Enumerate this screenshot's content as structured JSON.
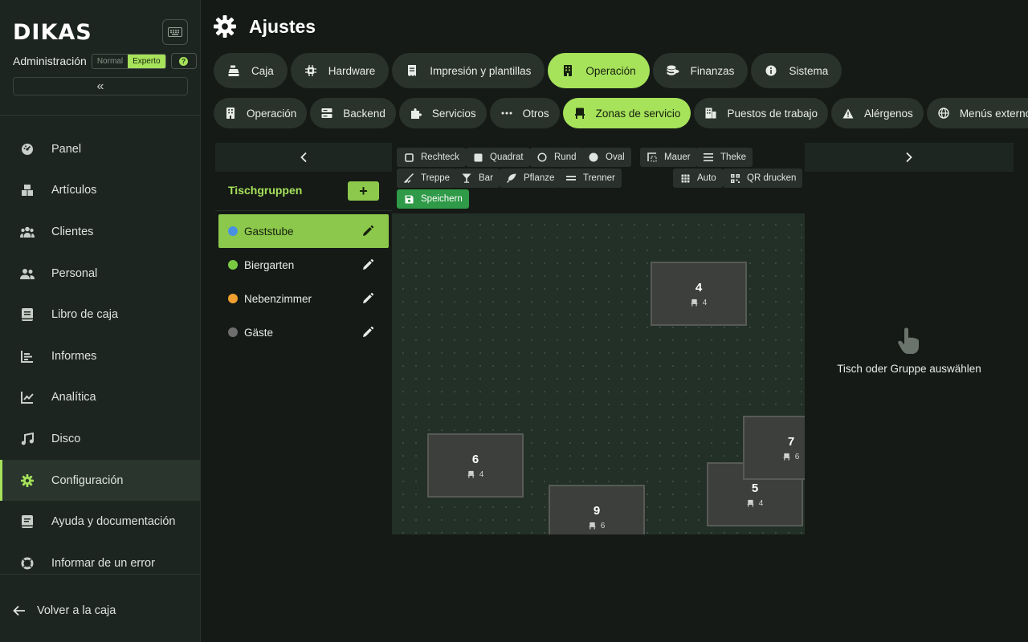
{
  "sidebar": {
    "logo": "DIKAS",
    "admin_label": "Administración",
    "modes": [
      "Normal",
      "Experto"
    ],
    "active_mode": "Experto",
    "help_glyph": "?",
    "collapse_glyph": "«",
    "nav": [
      {
        "label": "Panel",
        "icon": "dashboard-icon"
      },
      {
        "label": "Artículos",
        "icon": "boxes-icon"
      },
      {
        "label": "Clientes",
        "icon": "users-icon"
      },
      {
        "label": "Personal",
        "icon": "user-group-icon"
      },
      {
        "label": "Libro de caja",
        "icon": "book-icon"
      },
      {
        "label": "Informes",
        "icon": "bar-chart-icon"
      },
      {
        "label": "Analítica",
        "icon": "line-chart-icon"
      },
      {
        "label": "Disco",
        "icon": "music-icon"
      },
      {
        "label": "Configuración",
        "icon": "gear-icon",
        "active": true
      },
      {
        "label": "Ayuda y documentación",
        "icon": "help-book-icon"
      },
      {
        "label": "Informar de un error",
        "icon": "lifebuoy-icon"
      }
    ],
    "back_label": "Volver a la caja"
  },
  "header": {
    "title": "Ajustes"
  },
  "main_tabs": [
    {
      "label": "Caja",
      "icon": "register-icon"
    },
    {
      "label": "Hardware",
      "icon": "chip-icon"
    },
    {
      "label": "Impresión y plantillas",
      "icon": "receipt-icon"
    },
    {
      "label": "Operación",
      "icon": "building-icon",
      "active": true
    },
    {
      "label": "Finanzas",
      "icon": "coins-icon"
    },
    {
      "label": "Sistema",
      "icon": "info-icon"
    }
  ],
  "sub_tabs": [
    {
      "label": "Operación",
      "icon": "building-icon"
    },
    {
      "label": "Backend",
      "icon": "server-icon"
    },
    {
      "label": "Servicios",
      "icon": "puzzle-icon"
    },
    {
      "label": "Otros",
      "icon": "dots-icon"
    },
    {
      "label": "Zonas de servicio",
      "icon": "chair-icon",
      "active": true
    },
    {
      "label": "Puestos de trabajo",
      "icon": "workstation-icon"
    },
    {
      "label": "Alérgenos",
      "icon": "warning-icon"
    },
    {
      "label": "Menús externos",
      "icon": "globe-icon"
    }
  ],
  "groups_panel": {
    "title": "Tischgruppen",
    "add_glyph": "+",
    "groups": [
      {
        "name": "Gaststube",
        "color": "#4a90e2",
        "active": true
      },
      {
        "name": "Biergarten",
        "color": "#7ac943"
      },
      {
        "name": "Nebenzimmer",
        "color": "#f0a030"
      },
      {
        "name": "Gäste",
        "color": "#6e6e6e"
      }
    ]
  },
  "toolbar": {
    "rechteck": "Rechteck",
    "quadrat": "Quadrat",
    "rund": "Rund",
    "oval": "Oval",
    "mauer": "Mauer",
    "theke": "Theke",
    "treppe": "Treppe",
    "bar": "Bar",
    "pflanze": "Pflanze",
    "trenner": "Trenner",
    "auto": "Auto",
    "qr": "QR drucken",
    "save": "Speichern"
  },
  "tables": [
    {
      "number": "4",
      "seats": "4"
    },
    {
      "number": "6",
      "seats": "4"
    },
    {
      "number": "9",
      "seats": "6"
    },
    {
      "number": "5",
      "seats": "4"
    },
    {
      "number": "7",
      "seats": "6"
    }
  ],
  "detail_panel": {
    "empty_text": "Tisch oder Gruppe auswählen"
  },
  "colors": {
    "accent": "#a6e25a",
    "save": "#2f9a47",
    "background": "#151a16"
  }
}
